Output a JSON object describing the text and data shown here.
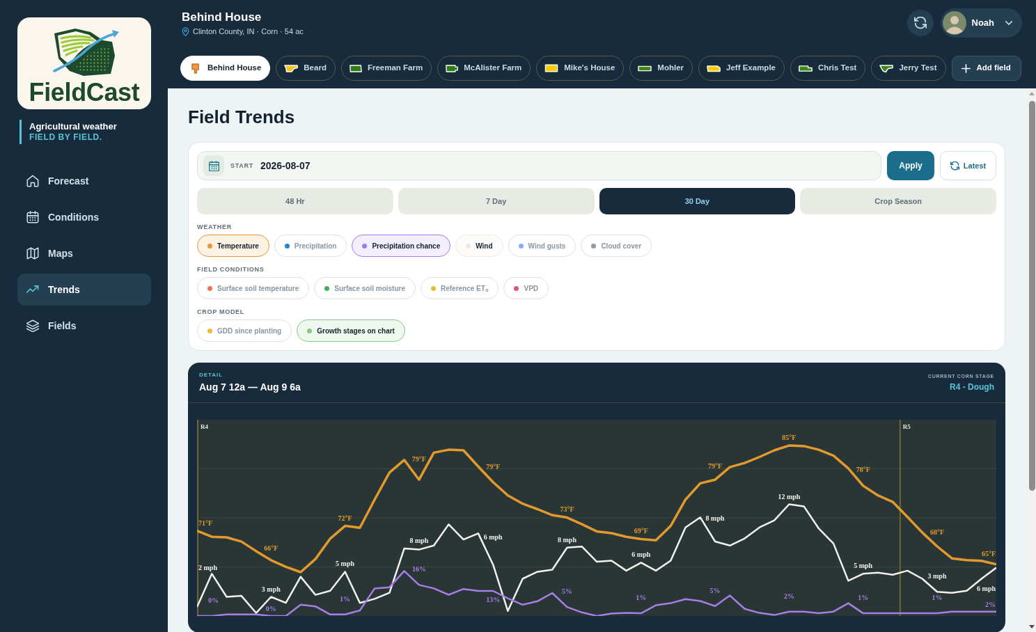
{
  "sidebar": {
    "brand": "FieldCast",
    "tagline": "Agricultural weather",
    "tagline_accent": "FIELD BY FIELD.",
    "nav": [
      {
        "label": "Forecast",
        "selected": false
      },
      {
        "label": "Conditions",
        "selected": false
      },
      {
        "label": "Maps",
        "selected": false
      },
      {
        "label": "Trends",
        "selected": true
      },
      {
        "label": "Fields",
        "selected": false
      }
    ]
  },
  "header": {
    "title": "Behind House",
    "location": "Clinton County, IN · Corn · 54 ac",
    "user": "Noah"
  },
  "field_tabs": [
    {
      "label": "Behind House",
      "color": "#eb9a45",
      "selected": true
    },
    {
      "label": "Beard",
      "color": "#f5c518",
      "selected": false
    },
    {
      "label": "Freeman Farm",
      "color": "#2f7d14",
      "selected": false
    },
    {
      "label": "McAlister Farm",
      "color": "#2f7d14",
      "selected": false
    },
    {
      "label": "Mike's House",
      "color": "#f7cc00",
      "selected": false
    },
    {
      "label": "Mohler",
      "color": "#3a8a18",
      "selected": false
    },
    {
      "label": "Jeff Example",
      "color": "#f7cc00",
      "selected": false
    },
    {
      "label": "Chris Test",
      "color": "#3a8a18",
      "selected": false
    },
    {
      "label": "Jerry Test",
      "color": "#3a8a18",
      "selected": false
    }
  ],
  "add_field": "Add field",
  "page_title": "Field Trends",
  "filters": {
    "start_label": "START",
    "start_value": "2026-08-07",
    "apply": "Apply",
    "latest": "Latest",
    "ranges": [
      {
        "label": "48 Hr",
        "selected": false
      },
      {
        "label": "7 Day",
        "selected": false
      },
      {
        "label": "30 Day",
        "selected": true
      },
      {
        "label": "Crop Season",
        "selected": false
      }
    ],
    "groups": [
      {
        "title": "WEATHER",
        "chips": [
          {
            "label": "Temperature",
            "color": "#e39a35",
            "selected": true
          },
          {
            "label": "Precipitation",
            "color": "#2288cc",
            "selected": false
          },
          {
            "label": "Precipitation chance",
            "color": "#a07ee8",
            "selected": true
          },
          {
            "label": "Wind",
            "color": "#efe9e2",
            "selected": true
          },
          {
            "label": "Wind gusts",
            "color": "#8ca8ff",
            "selected": false
          },
          {
            "label": "Cloud cover",
            "color": "#8b9bab",
            "selected": false
          }
        ]
      },
      {
        "title": "FIELD CONDITIONS",
        "chips": [
          {
            "label": "Surface soil temperature",
            "color": "#ec7552",
            "selected": false
          },
          {
            "label": "Surface soil moisture",
            "color": "#45b05a",
            "selected": false
          },
          {
            "label": "Reference ET$_{o}$",
            "color": "#e8bc38",
            "selected": false
          },
          {
            "label": "VPD",
            "color": "#e0527f",
            "selected": false
          }
        ]
      },
      {
        "title": "CROP MODEL",
        "chips": [
          {
            "label": "GDD since planting",
            "color": "#f2b73e",
            "selected": false
          },
          {
            "label": "Growth stages on chart",
            "color": "#86c886",
            "selected": true
          }
        ]
      }
    ]
  },
  "detail": {
    "eyebrow": "DETAIL",
    "range": "Aug 7 12a — Aug 9 6a",
    "stage_caption": "CURRENT CORN STAGE",
    "stage": "R4 - Dough",
    "chart": {
      "stage_markers": [
        "R4",
        "R5"
      ],
      "series": [
        {
          "color": "#e39a2d",
          "labels": [
            "71°F",
            "66°F",
            "72°F",
            "79°F",
            "79°F",
            "73°F",
            "69°F",
            "79°F",
            "85°F",
            "78°F",
            "68°F",
            "65°F"
          ]
        },
        {
          "color": "#f2f1ec",
          "labels": [
            "2 mph",
            "3 mph",
            "5 mph",
            "8 mph",
            "6 mph",
            "8 mph",
            "6 mph",
            "8 mph",
            "12 mph",
            "5 mph",
            "3 mph",
            "6 mph"
          ]
        },
        {
          "color": "#a67ee6",
          "labels": [
            "0%",
            "0%",
            "1%",
            "16%",
            "13%",
            "5%",
            "1%",
            "5%",
            "2%",
            "1%",
            "1%",
            "2%"
          ]
        }
      ]
    }
  }
}
